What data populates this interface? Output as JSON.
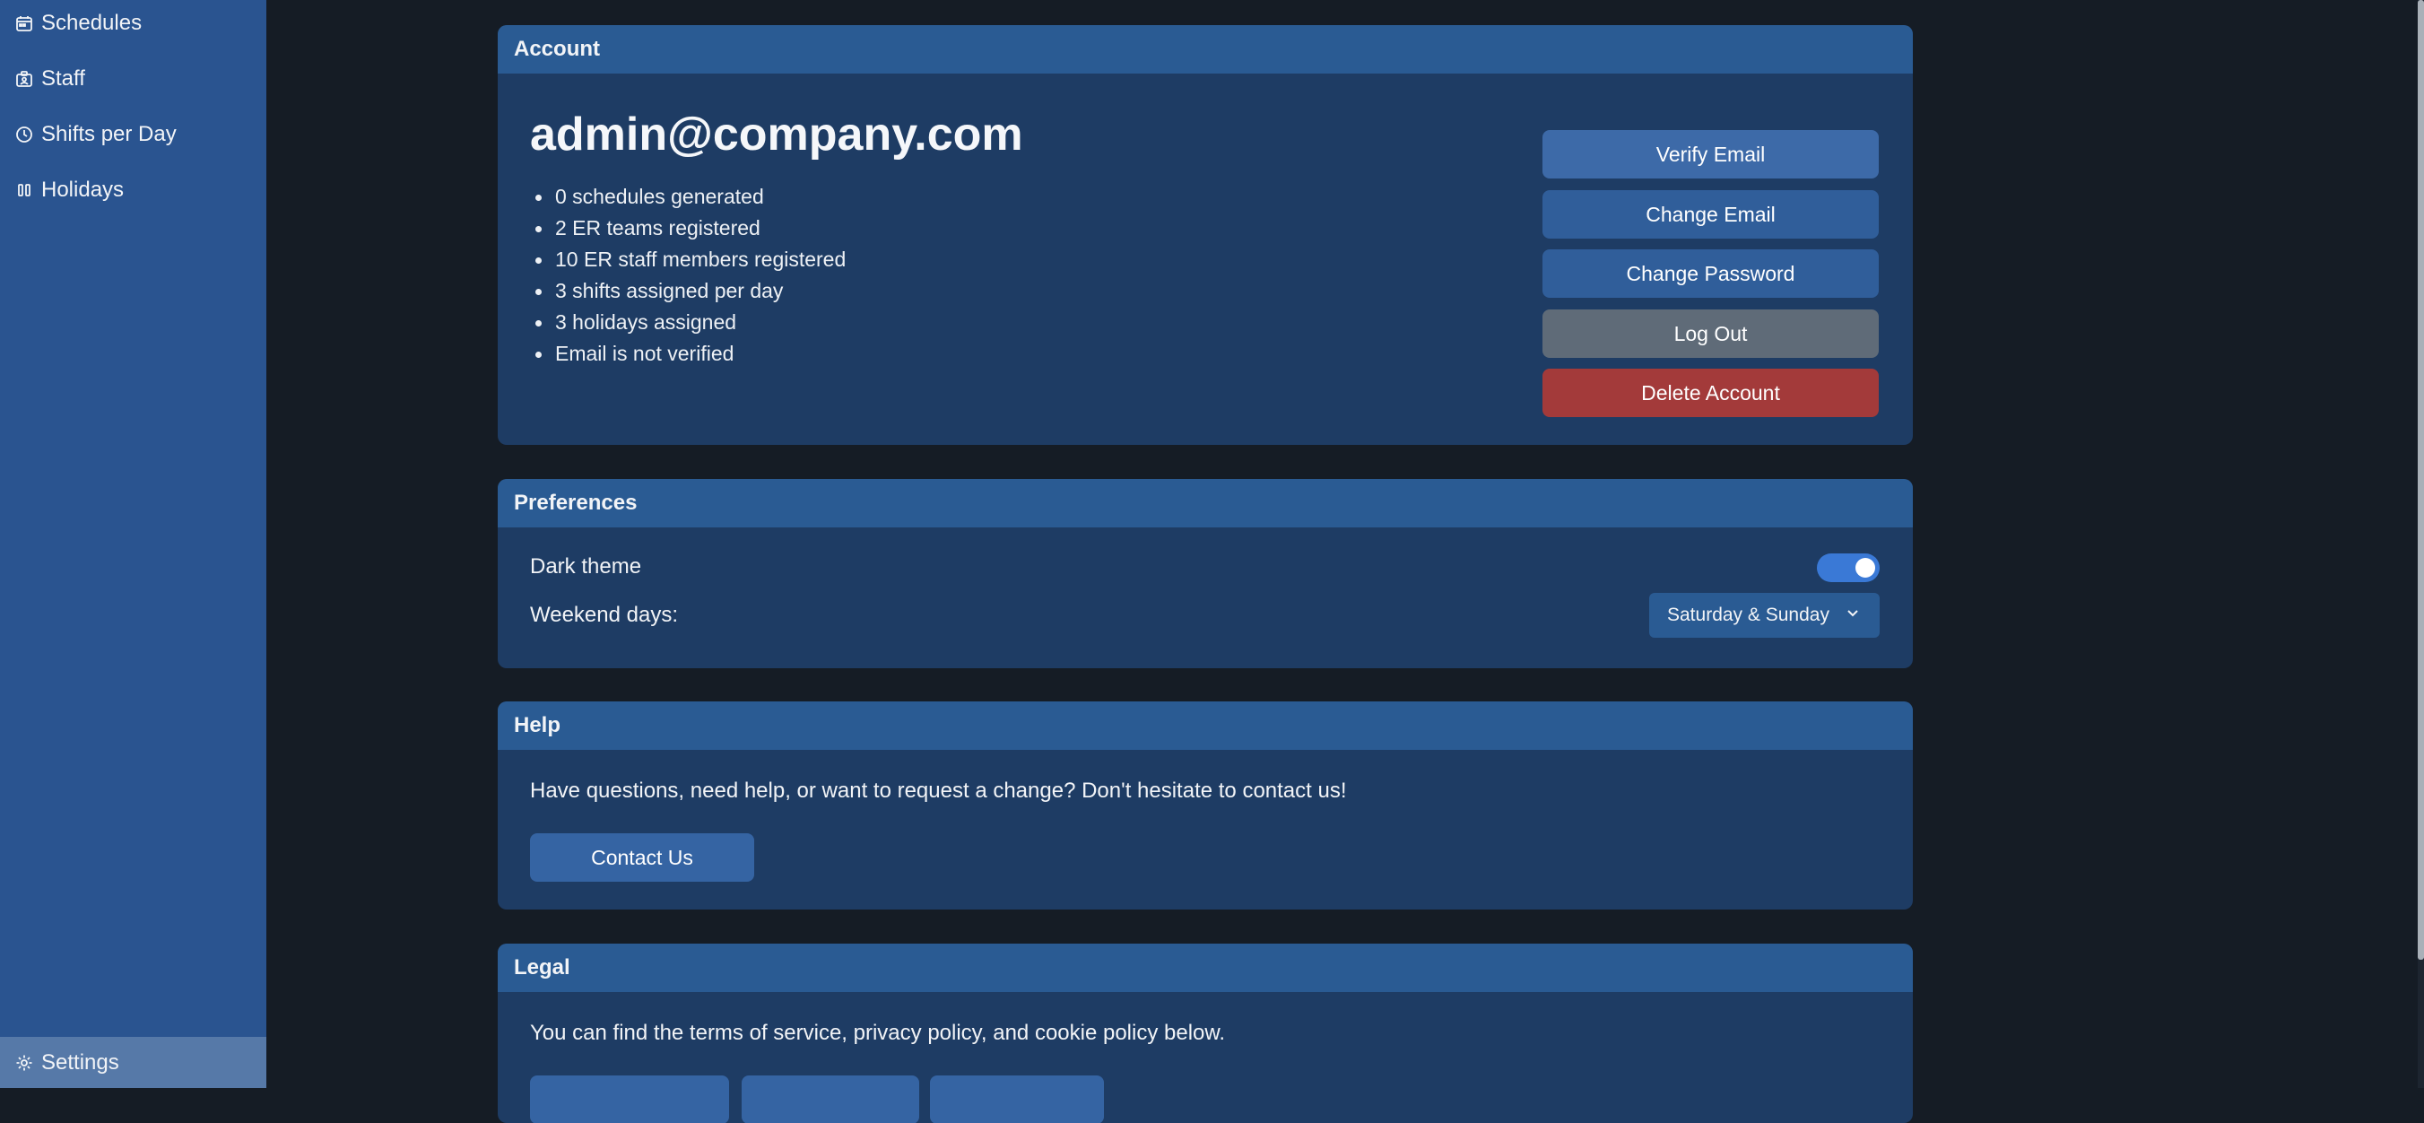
{
  "sidebar": {
    "items": [
      {
        "label": "Schedules",
        "icon": "calendar-icon"
      },
      {
        "label": "Staff",
        "icon": "id-badge-icon"
      },
      {
        "label": "Shifts per Day",
        "icon": "clock-icon"
      },
      {
        "label": "Holidays",
        "icon": "pause-icon"
      }
    ],
    "settings": {
      "label": "Settings",
      "icon": "gear-icon"
    }
  },
  "account": {
    "header": "Account",
    "email": "admin@company.com",
    "stats": [
      "0 schedules generated",
      "2 ER teams registered",
      "10 ER staff members registered",
      "3 shifts assigned per day",
      "3 holidays assigned",
      "Email is not verified"
    ],
    "buttons": {
      "verify_email": "Verify Email",
      "change_email": "Change Email",
      "change_password": "Change Password",
      "log_out": "Log Out",
      "delete_account": "Delete Account"
    }
  },
  "preferences": {
    "header": "Preferences",
    "dark_theme_label": "Dark theme",
    "dark_theme_on": true,
    "weekend_label": "Weekend days:",
    "weekend_value": "Saturday & Sunday"
  },
  "help": {
    "header": "Help",
    "text": "Have questions, need help, or want to request a change? Don't hesitate to contact us!",
    "contact_button": "Contact Us"
  },
  "legal": {
    "header": "Legal",
    "text": "You can find the terms of service, privacy policy, and cookie policy below."
  },
  "colors": {
    "background": "#151c25",
    "sidebar": "#2a5490",
    "card": "#1e3c64",
    "card_header": "#2a5b93",
    "danger": "#a33a3a",
    "toggle_on": "#3a79d6"
  }
}
